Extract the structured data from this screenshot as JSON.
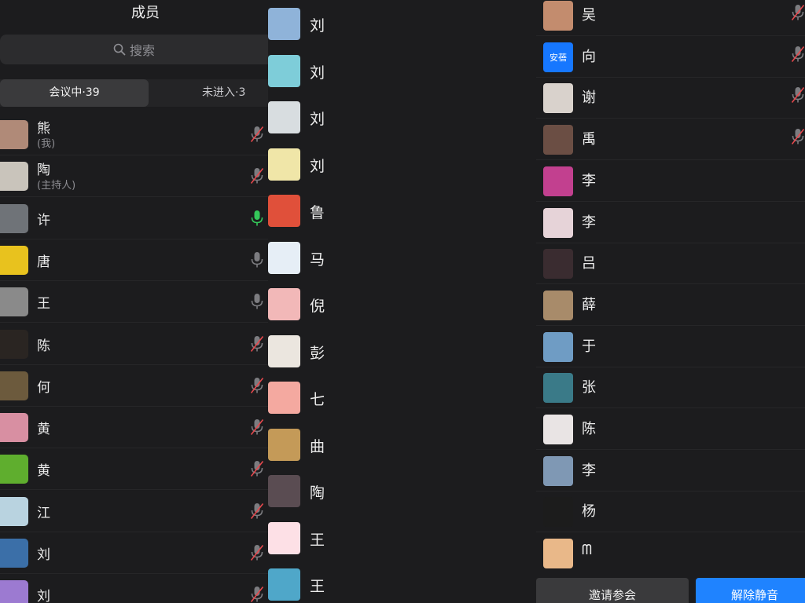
{
  "panel1": {
    "title": "成员",
    "search_placeholder": "搜索",
    "tabs": {
      "in_meeting": "会议中·39",
      "not_joined": "未进入·3"
    },
    "members": [
      {
        "name": "熊",
        "sub": "(我)",
        "mic": "muted",
        "avatar": "#b08a78"
      },
      {
        "name": "陶",
        "sub": "(主持人)",
        "mic": "muted",
        "avatar": "#c9c4bb"
      },
      {
        "name": "许",
        "sub": "",
        "mic": "speaking",
        "avatar": "#6f7378"
      },
      {
        "name": "唐",
        "sub": "",
        "mic": "on",
        "avatar": "#e8c21e"
      },
      {
        "name": "王",
        "sub": "",
        "mic": "on",
        "avatar": "#8a8a8a"
      },
      {
        "name": "陈",
        "sub": "",
        "mic": "muted",
        "avatar": "#2a2522"
      },
      {
        "name": "何",
        "sub": "",
        "mic": "muted",
        "avatar": "#6c5a3d"
      },
      {
        "name": "黄",
        "sub": "",
        "mic": "muted",
        "avatar": "#d88fa2"
      },
      {
        "name": "黄",
        "sub": "",
        "mic": "muted",
        "avatar": "#5fae2e"
      },
      {
        "name": "江",
        "sub": "",
        "mic": "muted",
        "avatar": "#b9d3e0"
      },
      {
        "name": "刘",
        "sub": "",
        "mic": "muted",
        "avatar": "#3b6fa8"
      },
      {
        "name": "刘",
        "sub": "",
        "mic": "muted",
        "avatar": "#9c7ad1"
      }
    ]
  },
  "panel2": {
    "members": [
      {
        "name": "刘",
        "avatar": "#8fb3d9"
      },
      {
        "name": "刘",
        "avatar": "#7ecdd9"
      },
      {
        "name": "刘",
        "avatar": "#d8dde0"
      },
      {
        "name": "刘",
        "avatar": "#f0e6a8"
      },
      {
        "name": "鲁",
        "avatar": "#e0503a"
      },
      {
        "name": "马",
        "avatar": "#e6eef6"
      },
      {
        "name": "倪",
        "avatar": "#f2b8b8"
      },
      {
        "name": "彭",
        "avatar": "#ebe6df"
      },
      {
        "name": "七",
        "avatar": "#f4a9a0"
      },
      {
        "name": "曲",
        "avatar": "#c49a58"
      },
      {
        "name": "陶",
        "avatar": "#5a4c52"
      },
      {
        "name": "王",
        "avatar": "#fde0e6"
      },
      {
        "name": "王",
        "avatar": "#4fa7c9"
      }
    ]
  },
  "panel3": {
    "members": [
      {
        "name": "吴",
        "mic": "muted",
        "avatar": "#c38c6e"
      },
      {
        "name": "向",
        "mic": "muted",
        "avatar": "#1677ff",
        "avatar_text": "安蓓"
      },
      {
        "name": "谢",
        "mic": "muted",
        "avatar": "#d9d2cc"
      },
      {
        "name": "禹",
        "mic": "muted",
        "avatar": "#6b4e44"
      },
      {
        "name": "李",
        "mic": "none",
        "avatar": "#c2408f"
      },
      {
        "name": "李",
        "mic": "none",
        "avatar": "#e6d3d8"
      },
      {
        "name": "吕",
        "mic": "none",
        "avatar": "#3a2c30"
      },
      {
        "name": "薛",
        "mic": "none",
        "avatar": "#a88b6a"
      },
      {
        "name": "于",
        "mic": "none",
        "avatar": "#6f9cc4"
      },
      {
        "name": "张",
        "mic": "none",
        "avatar": "#3a7a88"
      },
      {
        "name": "陈",
        "mic": "none",
        "avatar": "#e9e4e4"
      },
      {
        "name": "李",
        "mic": "none",
        "avatar": "#7f98b4"
      },
      {
        "name": "杨",
        "mic": "none",
        "avatar": "#1c1c1c"
      },
      {
        "name": "ᗰ",
        "mic": "none",
        "avatar": "#e9b889"
      }
    ],
    "buttons": {
      "invite": "邀请参会",
      "unmute": "解除静音"
    }
  },
  "colors": {
    "background": "#1c1c1e",
    "accent": "#1f83ff",
    "speaking": "#34c759",
    "muted": "#e5484d"
  },
  "icons": {
    "search": "search-icon",
    "mic": "microphone-icon",
    "mic_muted": "microphone-muted-icon"
  }
}
